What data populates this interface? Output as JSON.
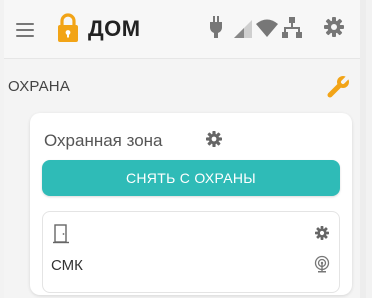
{
  "header": {
    "title": "ДОМ",
    "icons": [
      "menu-icon",
      "lock-icon",
      "power-plug-icon",
      "signal-icon",
      "wifi-icon",
      "network-icon",
      "settings-icon"
    ]
  },
  "section": {
    "title": "ОХРАНА",
    "action_icon": "wrench-icon"
  },
  "zone": {
    "title": "Охранная зона",
    "settings_icon": "gear-icon",
    "disarm_label": "СНЯТЬ С ОХРАНЫ"
  },
  "sensor": {
    "name": "СМК",
    "icon": "door-icon",
    "settings_icon": "gear-icon",
    "wireless_icon": "wireless-icon"
  },
  "colors": {
    "accent": "#2fbbb7",
    "lock": "#f2a417",
    "wrench": "#f2a417",
    "icon_gray": "#777777"
  }
}
